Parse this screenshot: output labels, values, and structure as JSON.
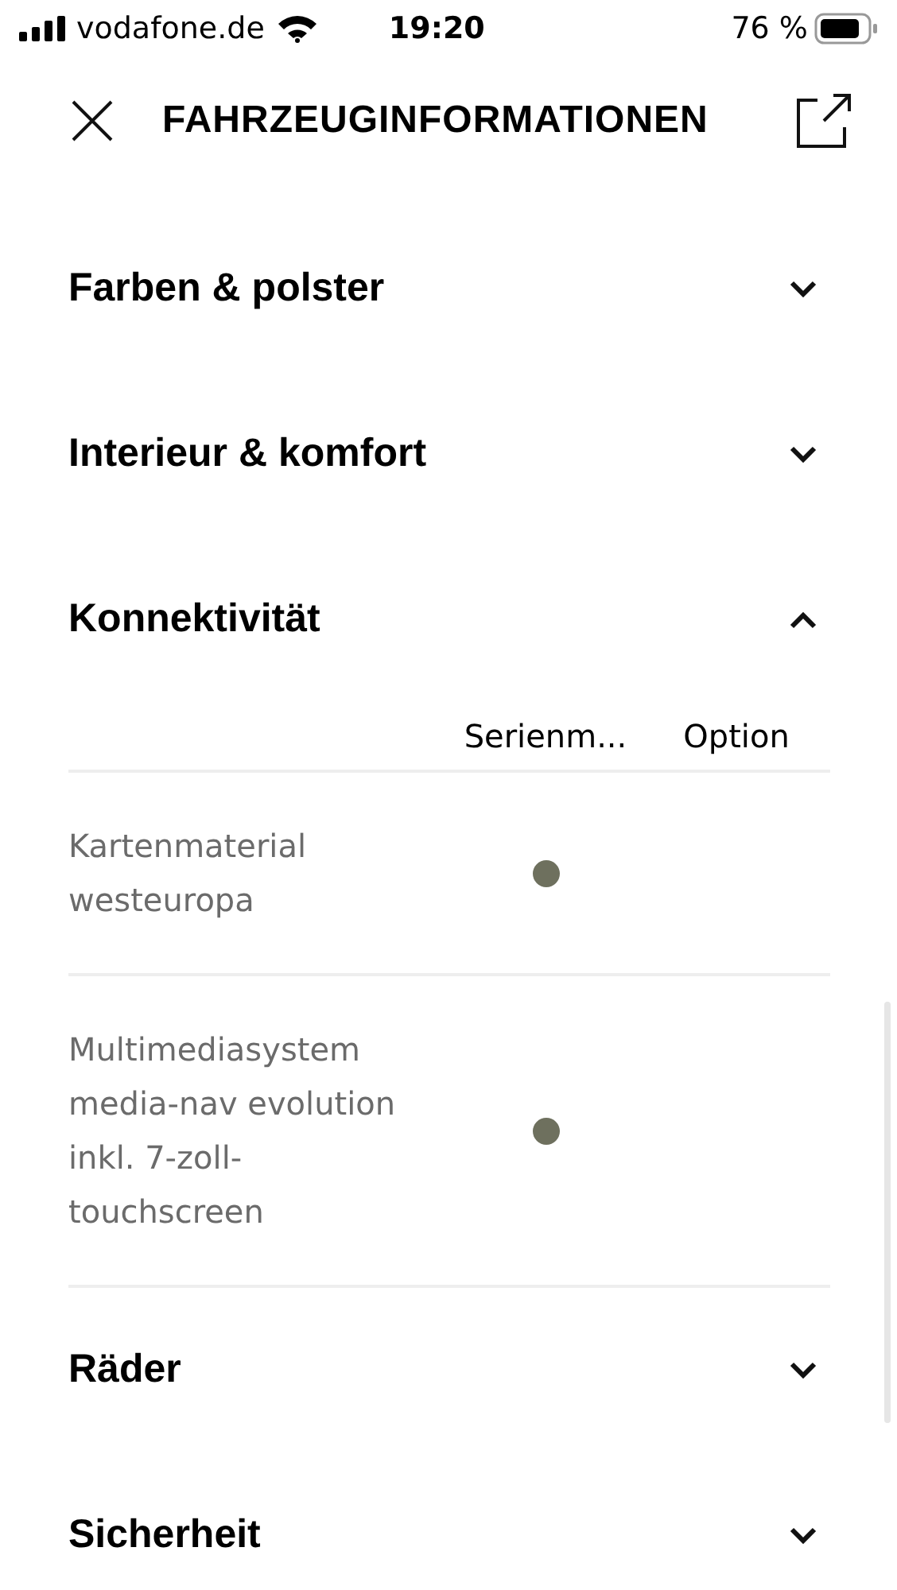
{
  "status_bar": {
    "carrier": "vodafone.de",
    "time": "19:20",
    "battery": "76 %"
  },
  "header": {
    "title": "FAHRZEUGINFORMATIONEN"
  },
  "sections": [
    {
      "title": "Farben & polster",
      "expanded": false
    },
    {
      "title": "Interieur & komfort",
      "expanded": false
    },
    {
      "title": "Konnektivität",
      "expanded": true,
      "columns": [
        "Serienm...",
        "Option"
      ],
      "rows": [
        {
          "name": "Kartenmaterial westeuropa",
          "standard": true,
          "option": false
        },
        {
          "name": "Multimediasystem media-nav evolution inkl. 7-zoll-touchscreen",
          "standard": true,
          "option": false
        }
      ]
    },
    {
      "title": "Räder",
      "expanded": false
    },
    {
      "title": "Sicherheit",
      "expanded": false
    }
  ]
}
